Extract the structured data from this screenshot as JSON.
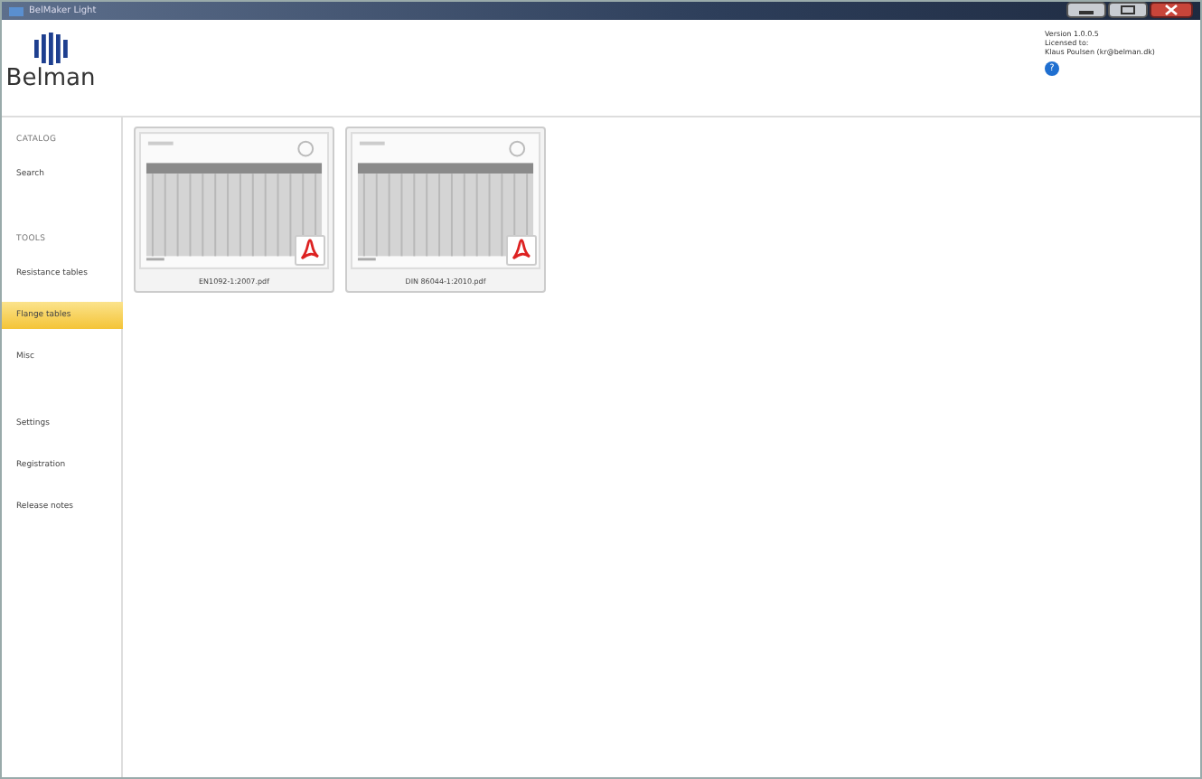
{
  "window": {
    "title": "BelMaker Light"
  },
  "header": {
    "logo_text": "Belman",
    "version": "Version 1.0.0.5",
    "license_label": "Licensed to:",
    "licensee": "Klaus Poulsen (kr@belman.dk)",
    "help_icon": "?"
  },
  "sidebar": {
    "sections": [
      {
        "heading": "CATALOG",
        "items": [
          {
            "label": "Search",
            "selected": false
          }
        ]
      },
      {
        "heading": "TOOLS",
        "items": [
          {
            "label": "Resistance tables",
            "selected": false
          },
          {
            "label": "Flange tables",
            "selected": true
          },
          {
            "label": "Misc",
            "selected": false
          }
        ]
      },
      {
        "items": [
          {
            "label": "Settings",
            "selected": false
          },
          {
            "label": "Registration",
            "selected": false
          },
          {
            "label": "Release notes",
            "selected": false
          }
        ]
      }
    ]
  },
  "documents": [
    {
      "file": "EN1092-1:2007.pdf"
    },
    {
      "file": "DIN 86044-1:2010.pdf"
    }
  ]
}
